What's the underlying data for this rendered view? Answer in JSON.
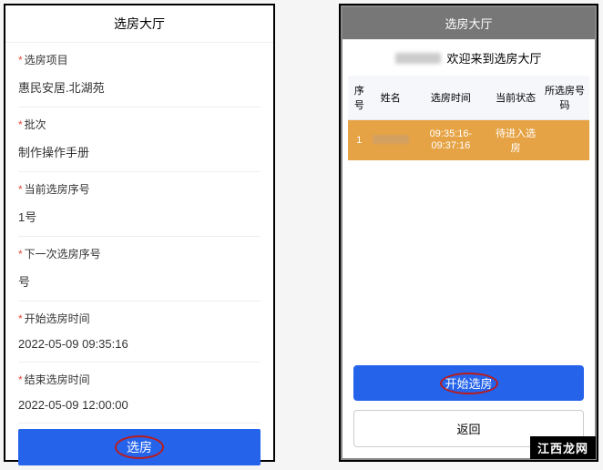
{
  "left": {
    "title": "选房大厅",
    "fields": [
      {
        "label": "选房项目",
        "value": "惠民安居.北湖苑",
        "required": true
      },
      {
        "label": "批次",
        "value": "制作操作手册",
        "required": true
      },
      {
        "label": "当前选房序号",
        "value": "1号",
        "required": true
      },
      {
        "label": "下一次选房序号",
        "value": "号",
        "required": true
      },
      {
        "label": "开始选房时间",
        "value": "2022-05-09 09:35:16",
        "required": true
      },
      {
        "label": "结束选房时间",
        "value": "2022-05-09 12:00:00",
        "required": true
      }
    ],
    "button": "选房"
  },
  "right": {
    "title": "选房大厅",
    "welcome": "欢迎来到选房大厅",
    "table": {
      "headers": [
        "序号",
        "姓名",
        "选房时间",
        "当前状态",
        "所选房号码"
      ],
      "rows": [
        {
          "seq": "1",
          "name": "",
          "time": "09:35:16-09:37:16",
          "status": "待进入选房",
          "room": ""
        }
      ]
    },
    "start_button": "开始选房",
    "back_button": "返回"
  },
  "watermark": "江西龙网"
}
